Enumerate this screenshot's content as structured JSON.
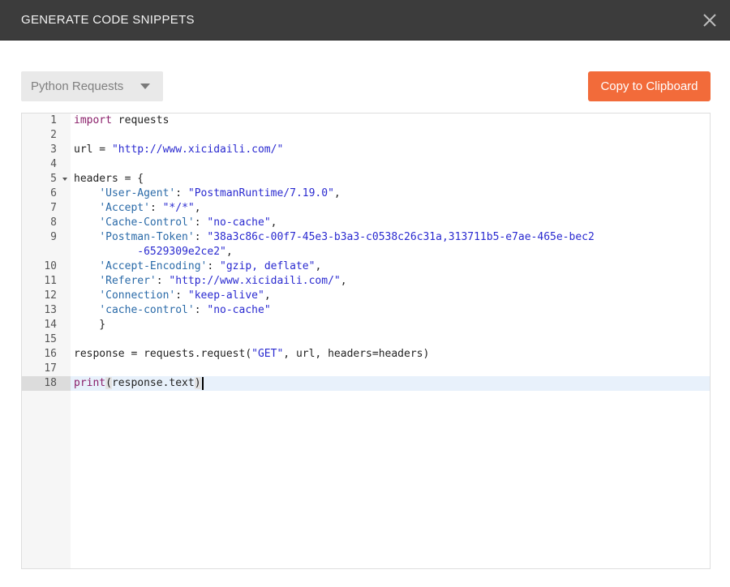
{
  "dialog": {
    "title": "GENERATE CODE SNIPPETS",
    "close_icon": "close-icon"
  },
  "toolbar": {
    "language_select_value": "Python Requests",
    "copy_button_label": "Copy to Clipboard",
    "accent_color": "#f26b3a"
  },
  "editor": {
    "line_numbers": [
      "1",
      "2",
      "3",
      "4",
      "5",
      "6",
      "7",
      "8",
      "9",
      "10",
      "11",
      "12",
      "13",
      "14",
      "15",
      "16",
      "17",
      "18"
    ],
    "active_line": "18",
    "code": {
      "l1_kw": "import",
      "l1_rest": " requests",
      "l3_a": "url",
      "l3_b": " = ",
      "l3_str": "\"http://www.xicidaili.com/\"",
      "l5_a": "headers",
      "l5_b": " = {",
      "h1_key": "'User-Agent'",
      "h1_val": "\"PostmanRuntime/7.19.0\"",
      "h2_key": "'Accept'",
      "h2_val": "\"*/*\"",
      "h3_key": "'Cache-Control'",
      "h3_val": "\"no-cache\"",
      "h4_key": "'Postman-Token'",
      "h4_val": "\"38a3c86c-00f7-45e3-b3a3-c0538c26c31a,313711b5-e7ae-465e-bec2",
      "h4_val_cont": "-6529309e2ce2\"",
      "h5_key": "'Accept-Encoding'",
      "h5_val": "\"gzip, deflate\"",
      "h6_key": "'Referer'",
      "h6_val": "\"http://www.xicidaili.com/\"",
      "h7_key": "'Connection'",
      "h7_val": "\"keep-alive\"",
      "h8_key": "'cache-control'",
      "h8_val": "\"no-cache\"",
      "l14": "    }",
      "l16_a": "response = requests.request(",
      "l16_str": "\"GET\"",
      "l16_b": ", url, headers=headers)",
      "l18_kw": "print",
      "l18_rest": "response.text"
    }
  }
}
